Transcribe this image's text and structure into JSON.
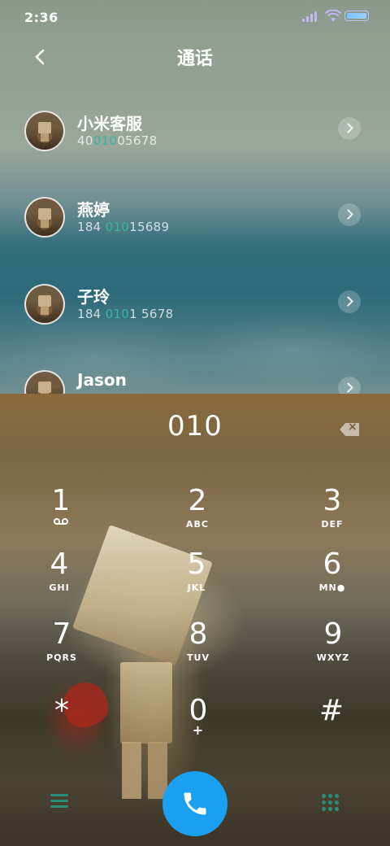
{
  "status_bar": {
    "time": "2:36"
  },
  "header": {
    "title": "通话"
  },
  "contacts": [
    {
      "name": "小米客服",
      "number_parts": [
        "40",
        "010",
        "05678"
      ]
    },
    {
      "name": "燕婷",
      "number_parts": [
        "184 ",
        "010",
        "15689"
      ]
    },
    {
      "name": "子玲",
      "number_parts": [
        "184 ",
        "010",
        "1 5678"
      ]
    },
    {
      "name": "Jason",
      "number_parts": [
        "",
        "",
        ""
      ]
    }
  ],
  "dialer": {
    "input": "010",
    "keys": [
      {
        "digit": "1",
        "letters": ""
      },
      {
        "digit": "2",
        "letters": "ABC"
      },
      {
        "digit": "3",
        "letters": "DEF"
      },
      {
        "digit": "4",
        "letters": "GHI"
      },
      {
        "digit": "5",
        "letters": "JKL"
      },
      {
        "digit": "6",
        "letters": "MN●"
      },
      {
        "digit": "7",
        "letters": "PQRS"
      },
      {
        "digit": "8",
        "letters": "TUV"
      },
      {
        "digit": "9",
        "letters": "WXYZ"
      },
      {
        "digit": "*",
        "letters": ""
      },
      {
        "digit": "0",
        "letters": "+"
      },
      {
        "digit": "#",
        "letters": ""
      }
    ]
  },
  "colors": {
    "highlight": "#38b6a5",
    "call_button": "#1aa0f0",
    "accent_icons": "#2c8c7a"
  },
  "icons": {
    "back": "chevron-left-icon",
    "row_chevron": "chevron-right-icon",
    "backspace": "backspace-icon",
    "menu": "menu-icon",
    "call": "phone-icon",
    "keypad": "dialpad-icon",
    "voicemail": "voicemail-icon"
  }
}
